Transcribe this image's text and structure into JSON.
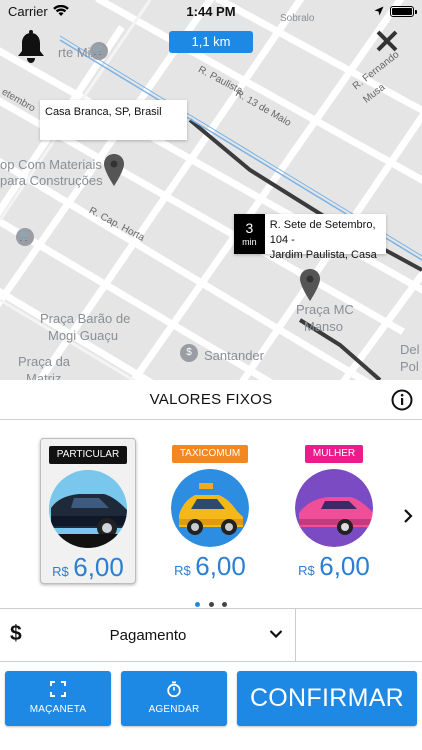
{
  "status_bar": {
    "carrier": "Carrier",
    "time": "1:44 PM"
  },
  "map": {
    "distance": "1,1 km",
    "labels": {
      "poi_mix": "rte Mix",
      "poi_material_1": "op Com Materiais",
      "poi_material_2": "para Construções",
      "street_paulista": "R. Paulista",
      "street_13maio": "R. 13 de Maio",
      "street_fernando": "R. Fernando Musa",
      "street_setembro": "etembro",
      "street_horta": "R. Cap. Horta",
      "praca_barao_1": "Praça Barão de",
      "praca_barao_2": "Mogi Guaçu",
      "praca_matriz_1": "Praça da",
      "praca_matriz_2": "Matriz",
      "praca_mc_1": "Praça MC",
      "praca_mc_2": "Manso",
      "santander": "Santander",
      "del_1": "Del",
      "del_2": "Pol",
      "top_fragment": "Sobralo"
    },
    "origin": "Casa Branca, SP, Brasil",
    "destination_eta_value": "3",
    "destination_eta_unit": "min",
    "destination_line1": "R. Sete de Setembro, 104 -",
    "destination_line2": "Jardim Paulista, Casa"
  },
  "section": {
    "title": "VALORES FIXOS"
  },
  "vehicles": [
    {
      "badge": "PARTICULAR",
      "badge_color": "#111111",
      "currency": "R$",
      "price": "6,00",
      "selected": true
    },
    {
      "badge": "TAXICOMUM",
      "badge_color": "#f5871f",
      "currency": "R$",
      "price": "6,00",
      "selected": false
    },
    {
      "badge": "MULHER",
      "badge_color": "#ec1b8c",
      "currency": "R$",
      "price": "6,00",
      "selected": false
    }
  ],
  "payment": {
    "icon": "$",
    "label": "Pagamento"
  },
  "buttons": {
    "macaneta": "MAÇANETA",
    "agendar": "AGENDAR",
    "confirmar": "CONFIRMAR"
  },
  "colors": {
    "accent": "#1e88e5",
    "price": "#2a7fd4"
  }
}
